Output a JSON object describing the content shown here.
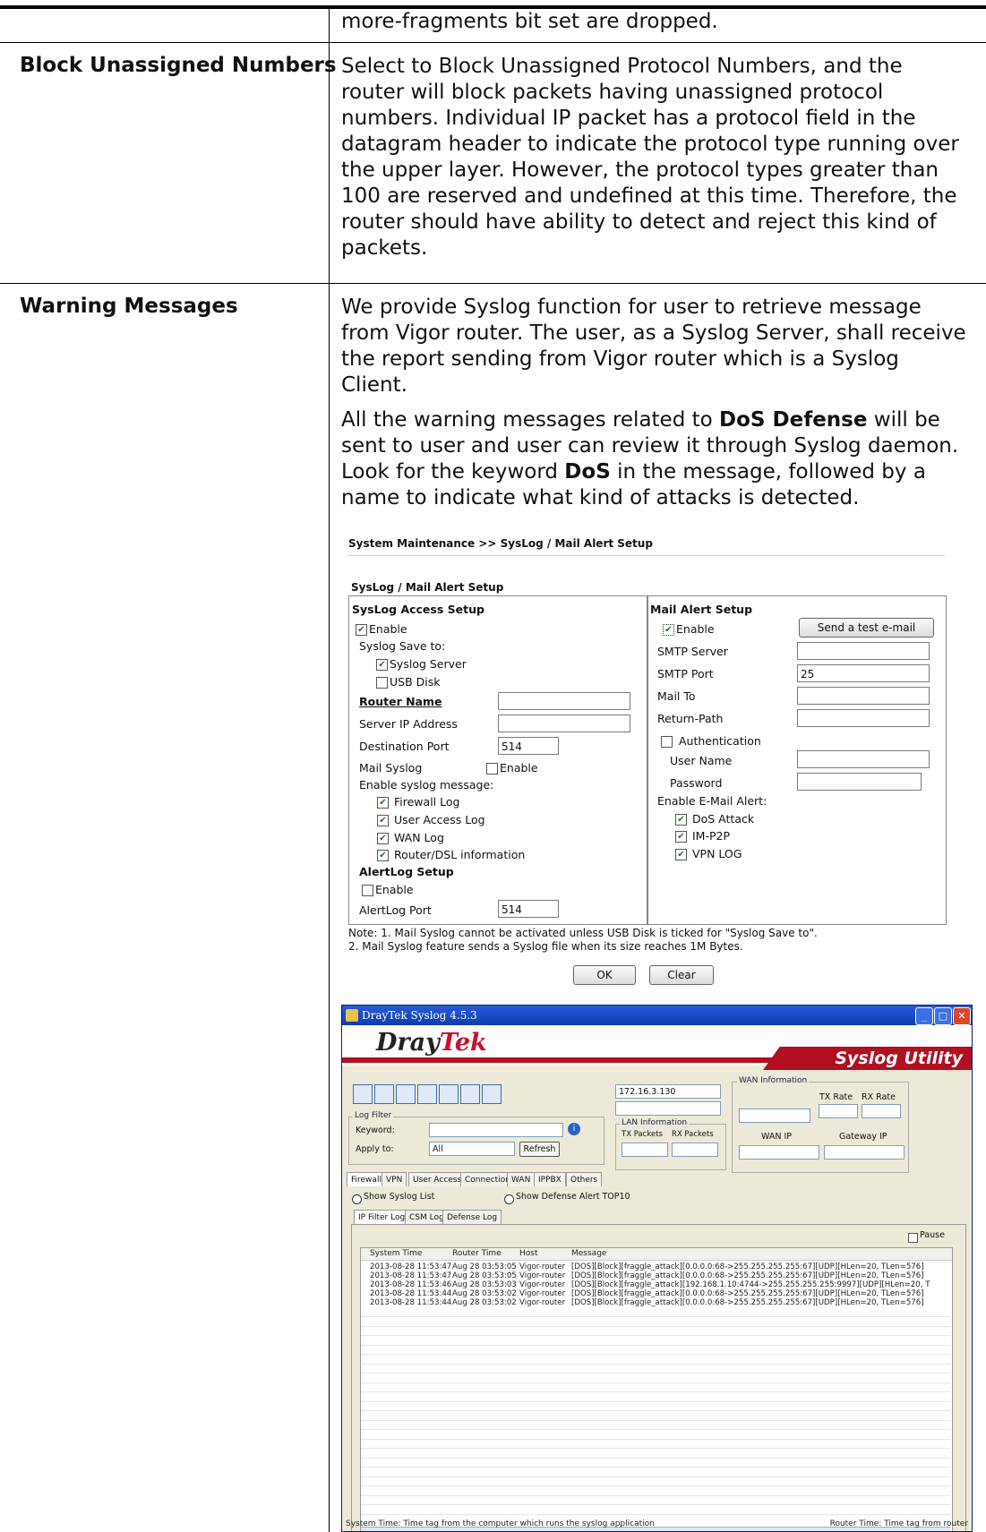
{
  "rows": {
    "continuation": "more-fragments bit set are dropped.",
    "block_unassigned": {
      "term": "Block Unassigned Numbers",
      "lines": [
        "Select to Block Unassigned Protocol Numbers, and the",
        "router will block packets having unassigned protocol",
        "numbers. Individual IP packet has a protocol field in the",
        "datagram header to indicate the protocol type running over",
        "the upper layer. However, the protocol types greater than",
        "100 are reserved and undefined at this time. Therefore, the",
        "router should have ability to detect and reject this kind of",
        "packets."
      ]
    },
    "warning_messages": {
      "term": "Warning Messages",
      "para1": [
        "We provide Syslog function for user to retrieve message",
        "from Vigor router. The user, as a Syslog Server, shall receive",
        "the report sending from Vigor router which is a Syslog",
        "Client."
      ],
      "p2_l1_a": "All the warning messages related to ",
      "p2_l1_b": "DoS Defense",
      "p2_l1_c": " will be",
      "p2_l2": "sent to user and user can review it through Syslog daemon.",
      "p2_l3_a": "Look for the keyword ",
      "p2_l3_b": "DoS",
      "p2_l3_c": " in the message, followed by a",
      "p2_l4": "name to indicate what kind of attacks is detected."
    }
  },
  "setup": {
    "breadcrumb": "System Maintenance >> SysLog / Mail Alert Setup",
    "section_title": "SysLog / Mail Alert Setup",
    "syslog": {
      "title": "SysLog Access Setup",
      "enable": "Enable",
      "save_to": "Syslog Save to:",
      "syslog_server": "Syslog Server",
      "usb_disk": "USB Disk",
      "router_name": "Router Name",
      "server_ip": "Server IP Address",
      "dest_port": "Destination Port",
      "dest_port_value": "514",
      "mail_syslog": "Mail Syslog",
      "mail_enable": "Enable",
      "enable_msg": "Enable syslog message:",
      "firewall_log": "Firewall Log",
      "user_access_log": "User Access Log",
      "wan_log": "WAN Log",
      "router_dsl": "Router/DSL information",
      "alertlog_title": "AlertLog Setup",
      "alert_enable": "Enable",
      "alertlog_port": "AlertLog Port",
      "alertlog_port_value": "514"
    },
    "mail": {
      "title": "Mail Alert Setup",
      "enable": "Enable",
      "send_test": "Send a test e-mail",
      "smtp_server": "SMTP Server",
      "smtp_port": "SMTP Port",
      "smtp_port_value": "25",
      "mail_to": "Mail To",
      "return_path": "Return-Path",
      "authentication": "Authentication",
      "user_name": "User Name",
      "password": "Password",
      "enable_alert": "Enable E-Mail Alert:",
      "dos_attack": "DoS Attack",
      "im_p2p": "IM-P2P",
      "vpn_log": "VPN LOG"
    },
    "note1": "Note: 1. Mail Syslog cannot be activated unless USB Disk is ticked for \"Syslog Save to\".",
    "note2": "2. Mail Syslog feature sends a Syslog file when its size reaches 1M Bytes.",
    "ok": "OK",
    "clear": "Clear"
  },
  "syslog_app": {
    "title": "DrayTek Syslog 4.5.3",
    "logo_a": "Dray",
    "logo_b": "Tek",
    "utility": "Syslog Utility",
    "ip_select": "172.16.3.130",
    "wan_info": "WAN Information",
    "tx_rate": "TX Rate",
    "rx_rate": "RX Rate",
    "lan_info": "LAN Information",
    "tx_packets": "TX Packets",
    "rx_packets": "RX Packets",
    "wan_ip": "WAN IP",
    "gateway_ip": "Gateway IP",
    "log_filter": "Log Filter",
    "keyword": "Keyword:",
    "apply_to": "Apply to:",
    "apply_value": "All",
    "refresh": "Refresh",
    "tabs": [
      "Firewall",
      "VPN",
      "User Access",
      "Connection",
      "WAN",
      "IPPBX",
      "Others"
    ],
    "show_syslog": "Show Syslog List",
    "show_defense": "Show Defense Alert TOP10",
    "subtabs": [
      "IP Filter Log",
      "CSM Log",
      "Defense Log"
    ],
    "pause": "Pause",
    "columns": [
      "System Time",
      "Router Time",
      "Host",
      "Message"
    ],
    "log_rows": [
      [
        "2013-08-28 11:53:47",
        "Aug 28 03:53:05",
        "Vigor-router",
        "[DOS][Block][fraggle_attack][0.0.0.0:68->255.255.255.255:67][UDP][HLen=20, TLen=576]"
      ],
      [
        "2013-08-28 11:53:47",
        "Aug 28 03:53:05",
        "Vigor-router",
        "[DOS][Block][fraggle_attack][0.0.0.0:68->255.255.255.255:67][UDP][HLen=20, TLen=576]"
      ],
      [
        "2013-08-28 11:53:46",
        "Aug 28 03:53:03",
        "Vigor-router",
        "[DOS][Block][fraggle_attack][192.168.1.10:4744->255.255.255.255:9997][UDP][HLen=20, T"
      ],
      [
        "2013-08-28 11:53:44",
        "Aug 28 03:53:02",
        "Vigor-router",
        "[DOS][Block][fraggle_attack][0.0.0.0:68->255.255.255.255:67][UDP][HLen=20, TLen=576]"
      ],
      [
        "2013-08-28 11:53:44",
        "Aug 28 03:53:02",
        "Vigor-router",
        "[DOS][Block][fraggle_attack][0.0.0.0:68->255.255.255.255:67][UDP][HLen=20, TLen=576]"
      ]
    ],
    "status_left": "System Time: Time tag from the computer which runs the syslog application",
    "status_right": "Router Time: Time tag from router"
  }
}
